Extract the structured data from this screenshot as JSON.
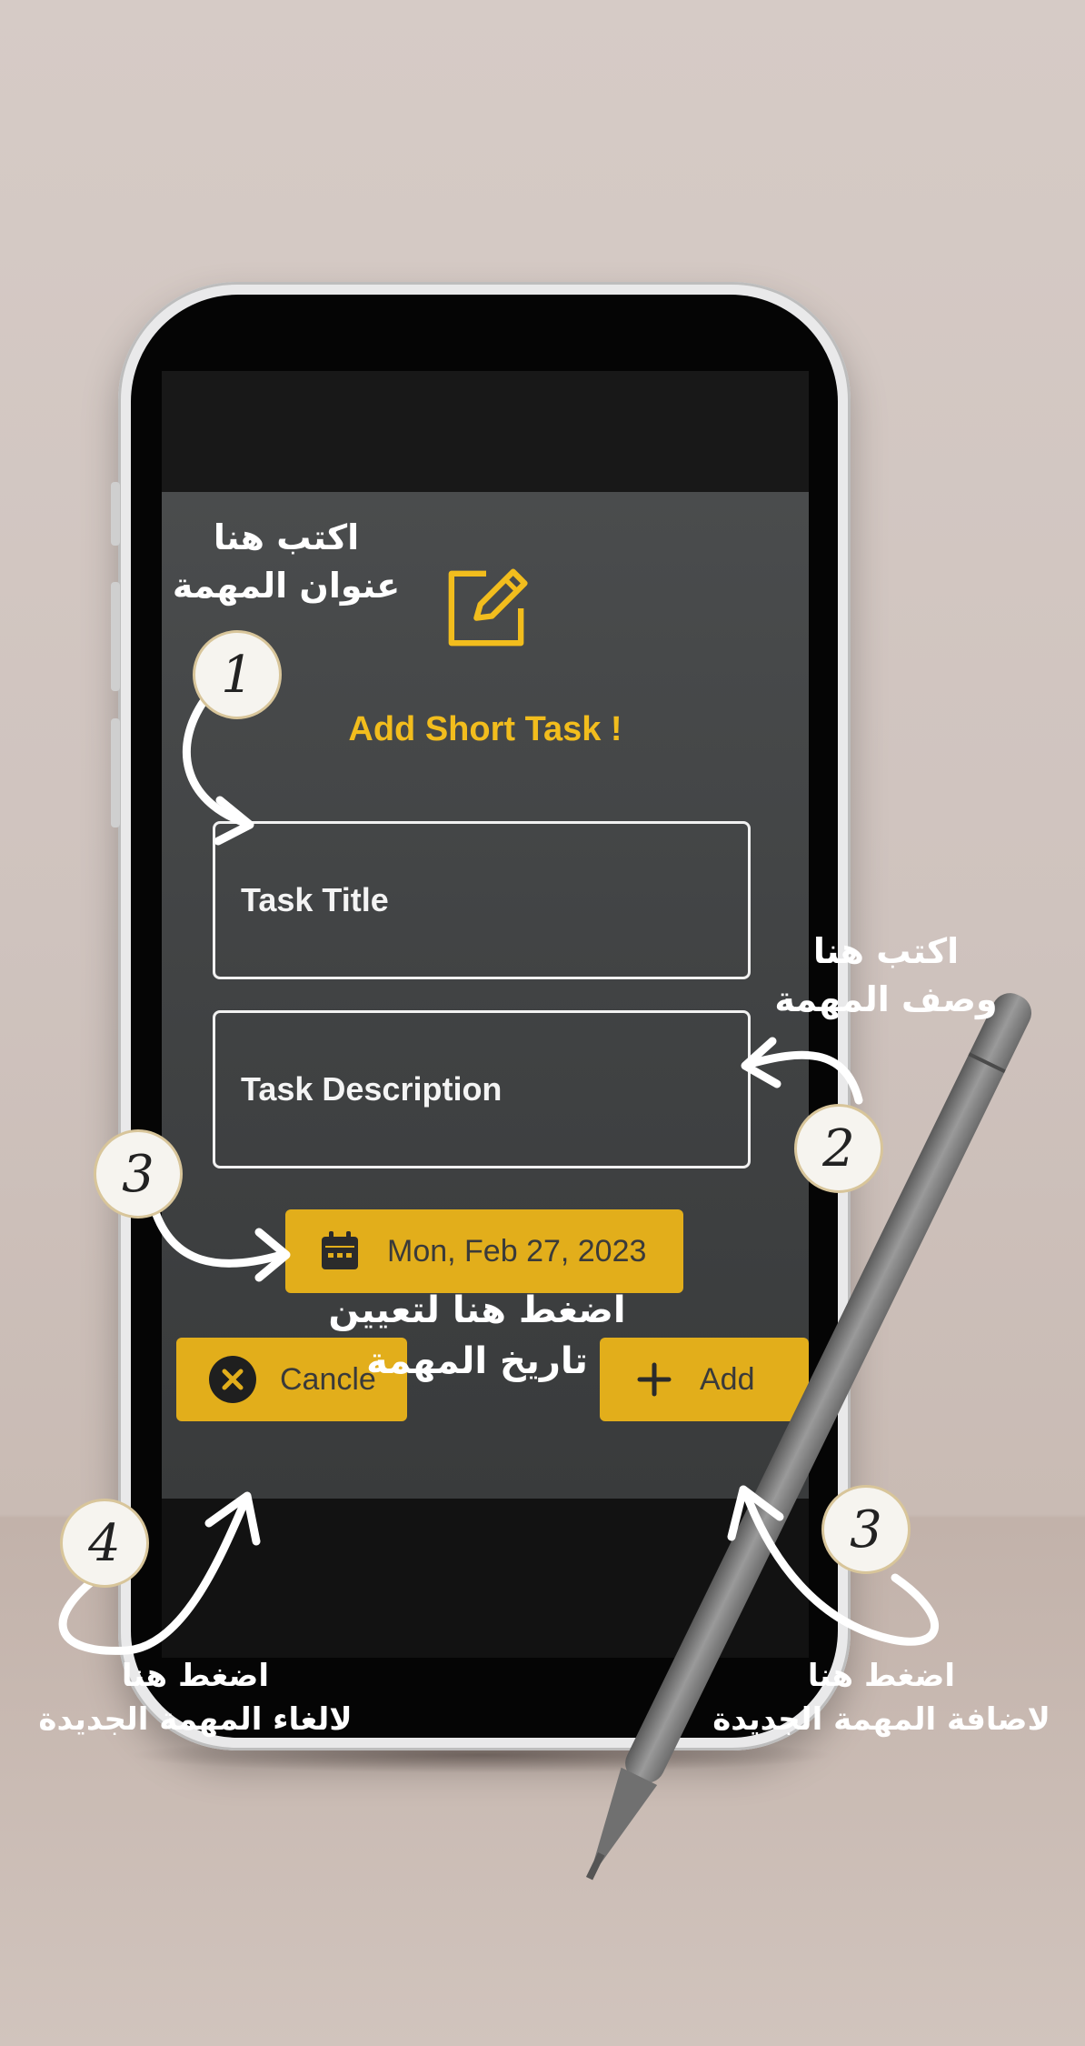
{
  "dialog": {
    "title": "Add Short Task !",
    "task_title_placeholder": "Task Title",
    "task_description_placeholder": "Task Description",
    "date_value": "Mon, Feb 27, 2023",
    "cancel_label": "Cancle",
    "add_label": "Add"
  },
  "annotations": {
    "title_hint": {
      "line1": "اكتب هنا",
      "line2": "عنوان المهمة",
      "badge": "1"
    },
    "description_hint": {
      "line1": "اكتب هنا",
      "line2": "وصف المهمة",
      "badge": "2"
    },
    "date_hint": {
      "line1": "اضغط هنا لتعيين",
      "line2": "تاريخ المهمة",
      "badge": "3"
    },
    "cancel_hint": {
      "line1": "اضغط هنا",
      "line2": "لالغاء المهمة الجديدة",
      "badge": "4"
    },
    "add_hint": {
      "line1": "اضغط هنا",
      "line2": "لاضافة المهمة الجديدة",
      "badge": "3"
    }
  },
  "colors": {
    "accent": "#e2ae1b",
    "title": "#f2bd1d",
    "dialog_bg": "#444647"
  },
  "icons": {
    "header": "edit-icon",
    "date": "calendar-icon",
    "cancel": "close-circle-icon",
    "add": "plus-icon"
  }
}
